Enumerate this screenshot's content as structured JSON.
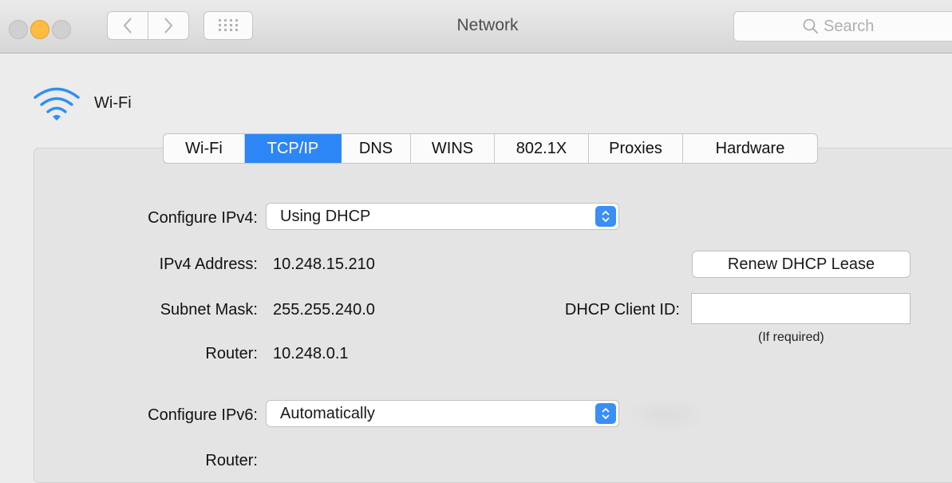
{
  "window": {
    "title": "Network"
  },
  "search": {
    "placeholder": "Search"
  },
  "interface": {
    "name": "Wi-Fi"
  },
  "tabs": [
    {
      "label": "Wi-Fi",
      "active": false
    },
    {
      "label": "TCP/IP",
      "active": true
    },
    {
      "label": "DNS",
      "active": false
    },
    {
      "label": "WINS",
      "active": false
    },
    {
      "label": "802.1X",
      "active": false
    },
    {
      "label": "Proxies",
      "active": false
    },
    {
      "label": "Hardware",
      "active": false
    }
  ],
  "ipv4": {
    "configure_label": "Configure IPv4:",
    "configure_value": "Using DHCP",
    "address_label": "IPv4 Address:",
    "address_value": "10.248.15.210",
    "subnet_label": "Subnet Mask:",
    "subnet_value": "255.255.240.0",
    "router_label": "Router:",
    "router_value": "10.248.0.1"
  },
  "dhcp": {
    "renew_label": "Renew DHCP Lease",
    "client_id_label": "DHCP Client ID:",
    "client_id_value": "",
    "client_id_note": "(If required)"
  },
  "ipv6": {
    "configure_label": "Configure IPv6:",
    "configure_value": "Automatically",
    "router_label": "Router:"
  },
  "colors": {
    "accent": "#2d86f5",
    "wifi_icon": "#2f8ff3",
    "minimize_light": "#fdbc40"
  }
}
